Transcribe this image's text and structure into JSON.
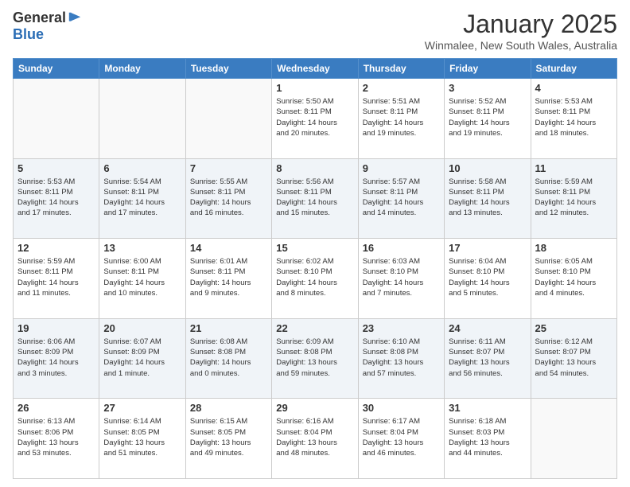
{
  "logo": {
    "general": "General",
    "blue": "Blue"
  },
  "header": {
    "month": "January 2025",
    "location": "Winmalee, New South Wales, Australia"
  },
  "days_of_week": [
    "Sunday",
    "Monday",
    "Tuesday",
    "Wednesday",
    "Thursday",
    "Friday",
    "Saturday"
  ],
  "weeks": [
    [
      {
        "day": "",
        "info": ""
      },
      {
        "day": "",
        "info": ""
      },
      {
        "day": "",
        "info": ""
      },
      {
        "day": "1",
        "info": "Sunrise: 5:50 AM\nSunset: 8:11 PM\nDaylight: 14 hours\nand 20 minutes."
      },
      {
        "day": "2",
        "info": "Sunrise: 5:51 AM\nSunset: 8:11 PM\nDaylight: 14 hours\nand 19 minutes."
      },
      {
        "day": "3",
        "info": "Sunrise: 5:52 AM\nSunset: 8:11 PM\nDaylight: 14 hours\nand 19 minutes."
      },
      {
        "day": "4",
        "info": "Sunrise: 5:53 AM\nSunset: 8:11 PM\nDaylight: 14 hours\nand 18 minutes."
      }
    ],
    [
      {
        "day": "5",
        "info": "Sunrise: 5:53 AM\nSunset: 8:11 PM\nDaylight: 14 hours\nand 17 minutes."
      },
      {
        "day": "6",
        "info": "Sunrise: 5:54 AM\nSunset: 8:11 PM\nDaylight: 14 hours\nand 17 minutes."
      },
      {
        "day": "7",
        "info": "Sunrise: 5:55 AM\nSunset: 8:11 PM\nDaylight: 14 hours\nand 16 minutes."
      },
      {
        "day": "8",
        "info": "Sunrise: 5:56 AM\nSunset: 8:11 PM\nDaylight: 14 hours\nand 15 minutes."
      },
      {
        "day": "9",
        "info": "Sunrise: 5:57 AM\nSunset: 8:11 PM\nDaylight: 14 hours\nand 14 minutes."
      },
      {
        "day": "10",
        "info": "Sunrise: 5:58 AM\nSunset: 8:11 PM\nDaylight: 14 hours\nand 13 minutes."
      },
      {
        "day": "11",
        "info": "Sunrise: 5:59 AM\nSunset: 8:11 PM\nDaylight: 14 hours\nand 12 minutes."
      }
    ],
    [
      {
        "day": "12",
        "info": "Sunrise: 5:59 AM\nSunset: 8:11 PM\nDaylight: 14 hours\nand 11 minutes."
      },
      {
        "day": "13",
        "info": "Sunrise: 6:00 AM\nSunset: 8:11 PM\nDaylight: 14 hours\nand 10 minutes."
      },
      {
        "day": "14",
        "info": "Sunrise: 6:01 AM\nSunset: 8:11 PM\nDaylight: 14 hours\nand 9 minutes."
      },
      {
        "day": "15",
        "info": "Sunrise: 6:02 AM\nSunset: 8:10 PM\nDaylight: 14 hours\nand 8 minutes."
      },
      {
        "day": "16",
        "info": "Sunrise: 6:03 AM\nSunset: 8:10 PM\nDaylight: 14 hours\nand 7 minutes."
      },
      {
        "day": "17",
        "info": "Sunrise: 6:04 AM\nSunset: 8:10 PM\nDaylight: 14 hours\nand 5 minutes."
      },
      {
        "day": "18",
        "info": "Sunrise: 6:05 AM\nSunset: 8:10 PM\nDaylight: 14 hours\nand 4 minutes."
      }
    ],
    [
      {
        "day": "19",
        "info": "Sunrise: 6:06 AM\nSunset: 8:09 PM\nDaylight: 14 hours\nand 3 minutes."
      },
      {
        "day": "20",
        "info": "Sunrise: 6:07 AM\nSunset: 8:09 PM\nDaylight: 14 hours\nand 1 minute."
      },
      {
        "day": "21",
        "info": "Sunrise: 6:08 AM\nSunset: 8:08 PM\nDaylight: 14 hours\nand 0 minutes."
      },
      {
        "day": "22",
        "info": "Sunrise: 6:09 AM\nSunset: 8:08 PM\nDaylight: 13 hours\nand 59 minutes."
      },
      {
        "day": "23",
        "info": "Sunrise: 6:10 AM\nSunset: 8:08 PM\nDaylight: 13 hours\nand 57 minutes."
      },
      {
        "day": "24",
        "info": "Sunrise: 6:11 AM\nSunset: 8:07 PM\nDaylight: 13 hours\nand 56 minutes."
      },
      {
        "day": "25",
        "info": "Sunrise: 6:12 AM\nSunset: 8:07 PM\nDaylight: 13 hours\nand 54 minutes."
      }
    ],
    [
      {
        "day": "26",
        "info": "Sunrise: 6:13 AM\nSunset: 8:06 PM\nDaylight: 13 hours\nand 53 minutes."
      },
      {
        "day": "27",
        "info": "Sunrise: 6:14 AM\nSunset: 8:05 PM\nDaylight: 13 hours\nand 51 minutes."
      },
      {
        "day": "28",
        "info": "Sunrise: 6:15 AM\nSunset: 8:05 PM\nDaylight: 13 hours\nand 49 minutes."
      },
      {
        "day": "29",
        "info": "Sunrise: 6:16 AM\nSunset: 8:04 PM\nDaylight: 13 hours\nand 48 minutes."
      },
      {
        "day": "30",
        "info": "Sunrise: 6:17 AM\nSunset: 8:04 PM\nDaylight: 13 hours\nand 46 minutes."
      },
      {
        "day": "31",
        "info": "Sunrise: 6:18 AM\nSunset: 8:03 PM\nDaylight: 13 hours\nand 44 minutes."
      },
      {
        "day": "",
        "info": ""
      }
    ]
  ]
}
